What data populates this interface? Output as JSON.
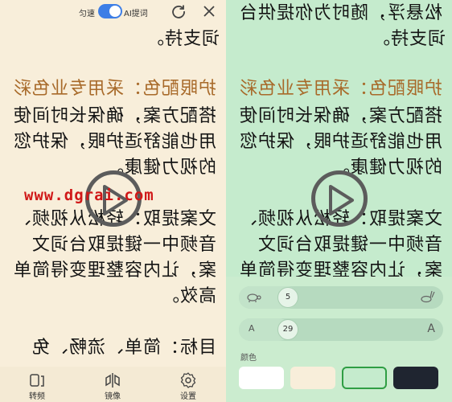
{
  "watermark": "www.dgrai.com",
  "left": {
    "top_bar": {
      "toggle_left_label": "匀速",
      "ai_label": "AI提词",
      "refresh_icon": "refresh-icon",
      "close_icon": "close-icon"
    },
    "lines": [
      {
        "text": "词支持。",
        "color": "#141414"
      },
      {
        "text": "护眼配色：采用专业色彩",
        "color": "#a86a2a"
      },
      {
        "text": "搭配方案，确保长时间使",
        "color": "#141414"
      },
      {
        "text": "用也能舒适护眼，保护您",
        "color": "#141414"
      },
      {
        "text": "的视力健康。",
        "color": "#141414"
      },
      {
        "text": "文案提取：轻松从视频、",
        "color": "#141414"
      },
      {
        "text": "音频中一键提取台词文",
        "color": "#141414"
      },
      {
        "text": "案，让内容整理变得简单",
        "color": "#141414"
      },
      {
        "text": "高效。",
        "color": "#141414"
      },
      {
        "text": "目标：简单、流畅、免",
        "color": "#141414"
      }
    ],
    "bottom_bar": [
      {
        "label": "转频",
        "icon": "mirror-flip-icon"
      },
      {
        "label": "镜像",
        "icon": "mirror-icon"
      },
      {
        "label": "设置",
        "icon": "gear-icon"
      }
    ]
  },
  "right": {
    "lines": [
      {
        "text": "松悬浮，随时为你提供台",
        "color": "#141414"
      },
      {
        "text": "词支持。",
        "color": "#141414"
      },
      {
        "text": "护眼配色：采用专业色彩",
        "color": "#a86a2a"
      },
      {
        "text": "搭配方案，确保长时间使",
        "color": "#141414"
      },
      {
        "text": "用也能舒适护眼，保护您",
        "color": "#141414"
      },
      {
        "text": "的视力健康。",
        "color": "#141414"
      },
      {
        "text": "文案提取：轻松从视频、",
        "color": "#141414"
      },
      {
        "text": "音频中一键提取台词文",
        "color": "#141414"
      },
      {
        "text": "案，让内容整理变得简单",
        "color": "#141414"
      }
    ],
    "panel": {
      "speed": {
        "value": "5",
        "slow_icon": "turtle-icon",
        "fast_icon": "rabbit-icon"
      },
      "font_size": {
        "value": "29",
        "min_label": "A",
        "max_label": "A"
      },
      "color_label": "颜色",
      "swatches": [
        "#ffffff",
        "#f8eeda",
        "#c5ebcd",
        "#1f2530"
      ]
    }
  }
}
